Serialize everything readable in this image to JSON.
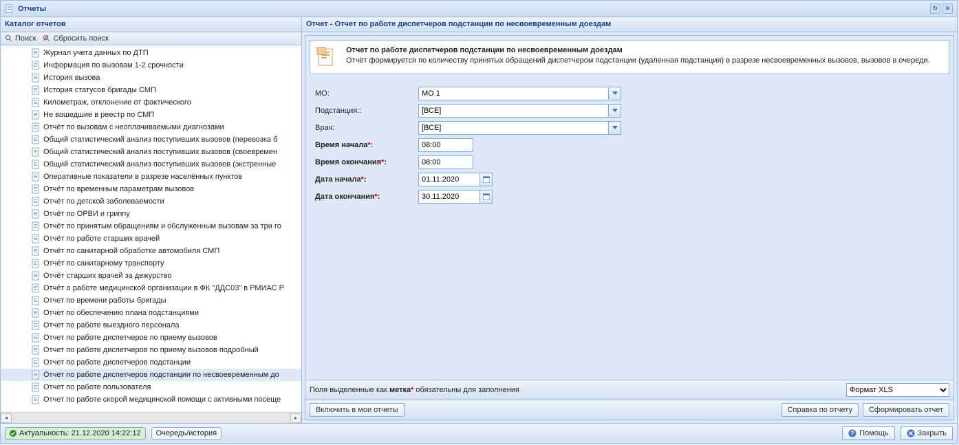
{
  "window": {
    "title": "Отчеты"
  },
  "left": {
    "header": "Каталог отчетов",
    "search": "Поиск",
    "reset": "Сбросить поиск",
    "items": [
      "Журнал учета данных по ДТП",
      "Информация по вызовам 1-2 срочности",
      "История вызова",
      "История статусов бригады СМП",
      "Километраж, отклонение от фактического",
      "Не вошедшие в реестр по СМП",
      "Отчёт по вызовам с неоплачиваемыми диагнозами",
      "Общий статистический анализ поступивших вызовов (перевозка б",
      "Общий статистический анализ поступивших вызовов (своевремен",
      "Общий статистический анализ поступивших вызовов (экстренные",
      "Оперативные показатели в разрезе населённых пунктов",
      "Отчёт по временным параметрам вызовов",
      "Отчёт по детской заболеваемости",
      "Отчёт по ОРВИ и гриппу",
      "Отчёт по принятым обращениям и обслуженным вызовам за три го",
      "Отчёт по работе старших врачей",
      "Отчёт по санитарной обработке автомобиля СМП",
      "Отчёт по санитарному транспорту",
      "Отчёт старших врачей за дежурство",
      "Отчёт о работе медицинской организации в ФК \"ДДС03\" в РМИАС Р",
      "Отчет по времени работы бригады",
      "Отчет по обеспечению плана подстанциями",
      "Отчет по работе выездного персонала",
      "Отчет по работе диспетчеров по приему вызовов",
      "Отчет по работе диспетчеров по приему вызовов подробный",
      "Отчет по работе диспетчеров подстанции",
      "Отчет по работе диспетчеров подстанции по несвоевременным до",
      "Отчет по работе пользователя",
      "Отчет по работе скорой медицинской помощи с активными посеще"
    ],
    "selected_index": 26
  },
  "right": {
    "header": "Отчет - Отчет по работе диспетчеров подстанции по несвоевременным доездам",
    "info_title": "Отчет по работе диспетчеров подстанции по несвоевременным доездам",
    "info_desc": "Отчёт формируется по количеству принятых обращений диспетчером подстанции (удаленная подстанция) в разрезе несвоевременных вызовов, вызовов в очереди.",
    "form": {
      "mo_label": "МО:",
      "mo_value": "МО 1",
      "substation_label": "Подстанция::",
      "substation_value": "[ВСЕ]",
      "doctor_label": "Врач:",
      "doctor_value": "[ВСЕ]",
      "start_time_label_pre": "Время начала",
      "start_time_value": "08:00",
      "end_time_label_pre": "Время окончания",
      "end_time_value": "08:00",
      "start_date_label_pre": "Дата начала",
      "start_date_value": "01.11.2020",
      "end_date_label_pre": "Дата окончания",
      "end_date_value": "30.11.2020"
    },
    "hint_pre": "Поля выделенные как ",
    "hint_word": "метка",
    "hint_post": " обязательны для заполнения",
    "format_label": "Формат XLS",
    "btn_include": "Включить в мои отчеты",
    "btn_help_report": "Справка по отчету",
    "btn_form": "Сформировать отчет"
  },
  "status": {
    "actuality": "Актуальность: 21.12.2020 14:22:12",
    "queue": "Очередь/история",
    "help": "Помощь",
    "close": "Закрыть"
  }
}
